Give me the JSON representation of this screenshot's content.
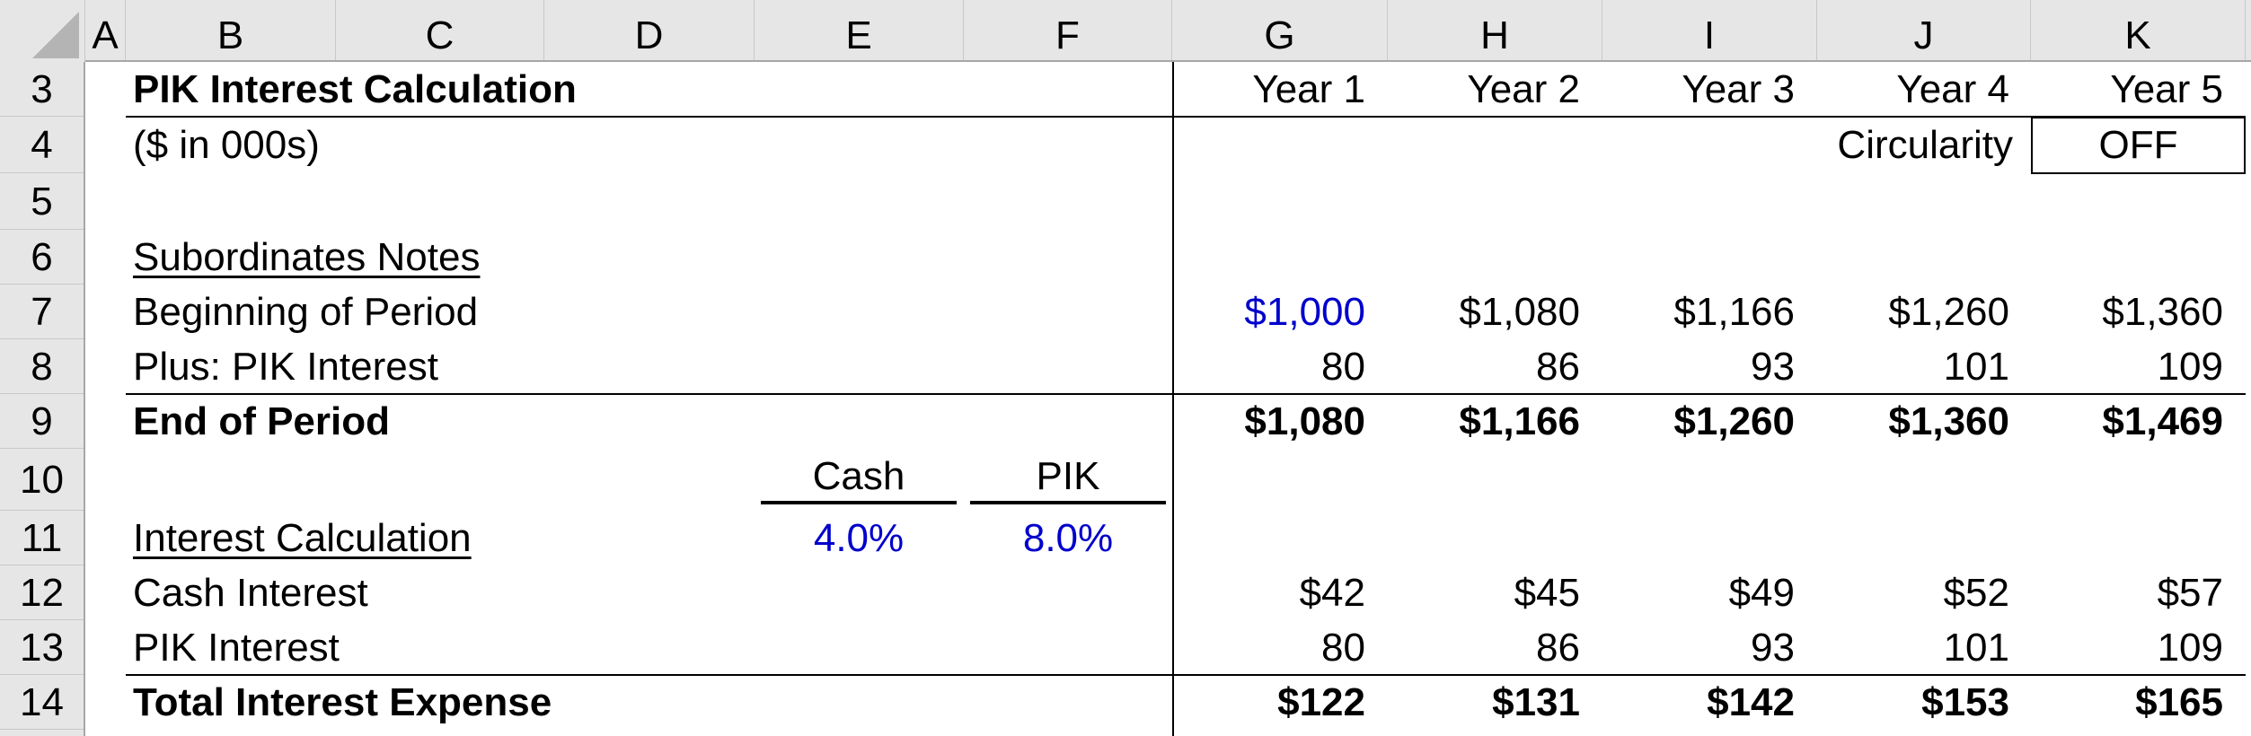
{
  "columns": [
    "A",
    "B",
    "C",
    "D",
    "E",
    "F",
    "G",
    "H",
    "I",
    "J",
    "K"
  ],
  "rows": [
    "3",
    "4",
    "5",
    "6",
    "7",
    "8",
    "9",
    "10",
    "11",
    "12",
    "13",
    "14"
  ],
  "title": "PIK Interest Calculation",
  "units": "($ in 000s)",
  "years": [
    "Year 1",
    "Year 2",
    "Year 3",
    "Year 4",
    "Year 5"
  ],
  "circularity": {
    "label": "Circularity",
    "value": "OFF"
  },
  "notes": {
    "section_label": "Subordinates Notes",
    "beginning_label": "Beginning of Period",
    "pik_label": "Plus: PIK Interest",
    "end_label": "End of Period",
    "beginning": [
      "$1,000",
      "$1,080",
      "$1,166",
      "$1,260",
      "$1,360"
    ],
    "pik": [
      "80",
      "86",
      "93",
      "101",
      "109"
    ],
    "end": [
      "$1,080",
      "$1,166",
      "$1,260",
      "$1,360",
      "$1,469"
    ]
  },
  "interest": {
    "section_label": "Interest Calculation",
    "cash_header": "Cash",
    "pik_header": "PIK",
    "cash_rate": "4.0%",
    "pik_rate": "8.0%",
    "cash_label": "Cash Interest",
    "pik_label": "PIK Interest",
    "total_label": "Total Interest Expense",
    "cash": [
      "$42",
      "$45",
      "$49",
      "$52",
      "$57"
    ],
    "pik": [
      "80",
      "86",
      "93",
      "101",
      "109"
    ],
    "total": [
      "$122",
      "$131",
      "$142",
      "$153",
      "$165"
    ]
  },
  "colors": {
    "input_blue": "#0000cc",
    "header_gray": "#e6e6e6"
  }
}
